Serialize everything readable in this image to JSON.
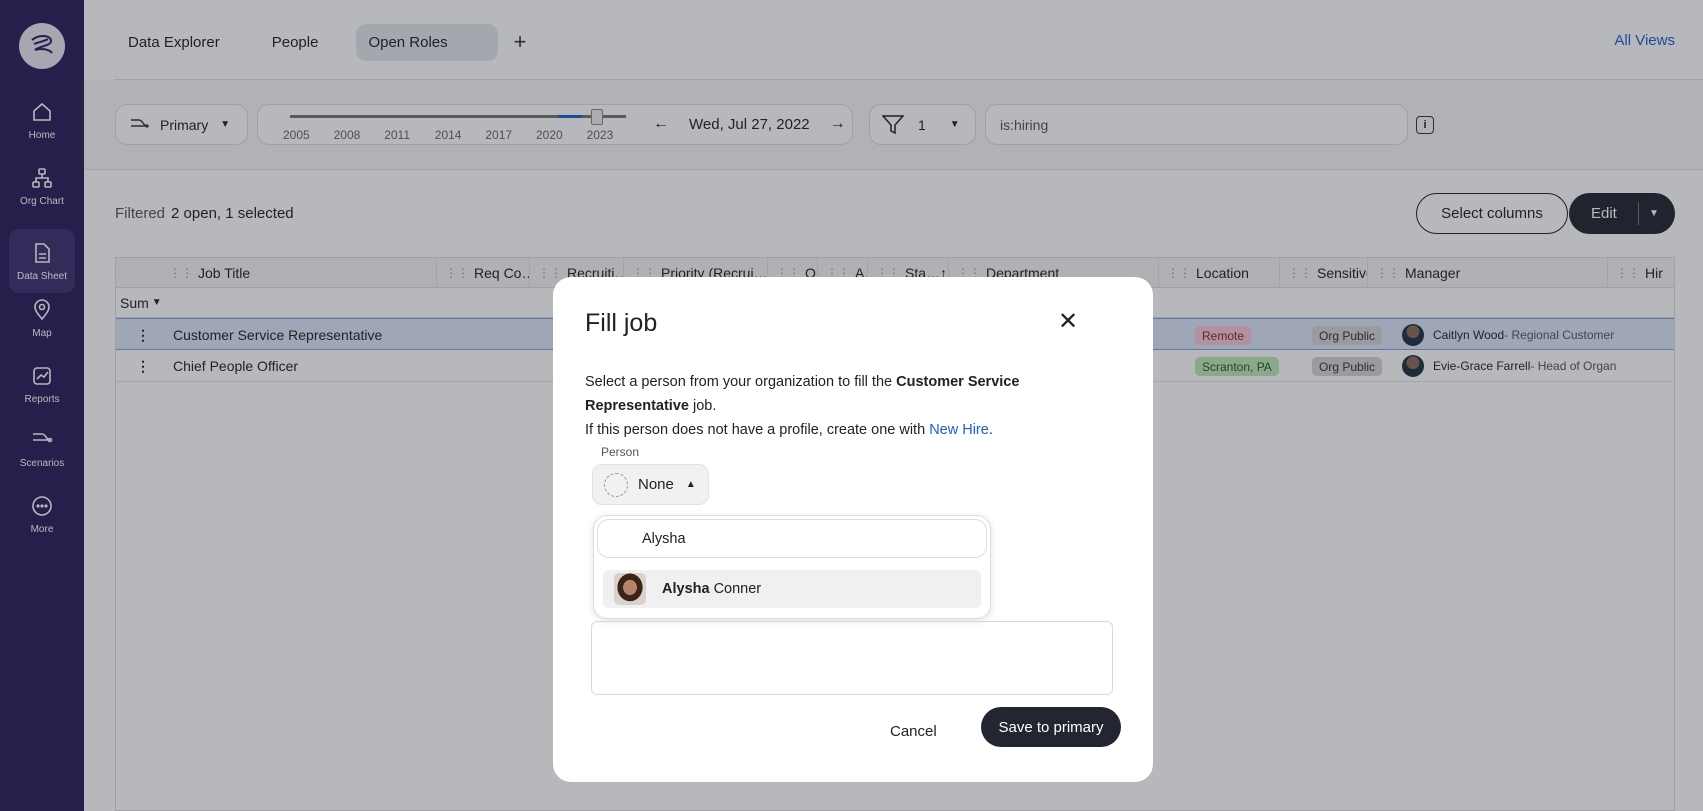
{
  "sidebar": {
    "items": [
      {
        "label": "Home",
        "icon": "home-icon"
      },
      {
        "label": "Org Chart",
        "icon": "org-chart-icon"
      },
      {
        "label": "Data Sheet",
        "icon": "data-sheet-icon"
      },
      {
        "label": "Map",
        "icon": "map-pin-icon"
      },
      {
        "label": "Reports",
        "icon": "reports-icon"
      },
      {
        "label": "Scenarios",
        "icon": "scenarios-icon"
      },
      {
        "label": "More",
        "icon": "more-icon"
      }
    ]
  },
  "tabs": [
    "Data Explorer",
    "People",
    "Open Roles"
  ],
  "all_views": "All Views",
  "toolbar": {
    "primary_label": "Primary",
    "years": [
      "2005",
      "2008",
      "2011",
      "2014",
      "2017",
      "2020",
      "2023"
    ],
    "date": "Wed, Jul 27, 2022",
    "filter_count": "1",
    "search": "is:hiring"
  },
  "status": {
    "filtered": "Filtered",
    "summary": "2 open, 1 selected"
  },
  "actions": {
    "select_columns": "Select columns",
    "edit": "Edit"
  },
  "table": {
    "columns": [
      "Job Title",
      "Req Co…",
      "Recruiti…",
      "Priority (Recrui…",
      "O…",
      "A…",
      "Sta…",
      "Department",
      "Location",
      "Sensitive",
      "Manager",
      "Hir"
    ],
    "sum_label": "Sum",
    "rows": [
      {
        "title": "Customer Service Representative",
        "location": "Remote",
        "sensitive": "Org Public",
        "manager_name": "Caitlyn Wood",
        "manager_role": " - Regional Customer"
      },
      {
        "title": "Chief People Officer",
        "location": "Scranton, PA",
        "sensitive": "Org Public",
        "manager_name": "Evie-Grace Farrell",
        "manager_role": " - Head of Organ"
      }
    ]
  },
  "modal": {
    "title": "Fill job",
    "desc_prefix": "Select a person from your organization to fill the ",
    "job_name": "Customer Service Representative",
    "desc_suffix": " job.",
    "desc_line2": "If this person does not have a profile, create one with ",
    "new_hire": "New Hire",
    "person_label": "Person",
    "person_value": "None",
    "search_value": "Alysha",
    "option_first": "Alysha",
    "option_last": "Conner",
    "cancel": "Cancel",
    "save": "Save to primary"
  }
}
